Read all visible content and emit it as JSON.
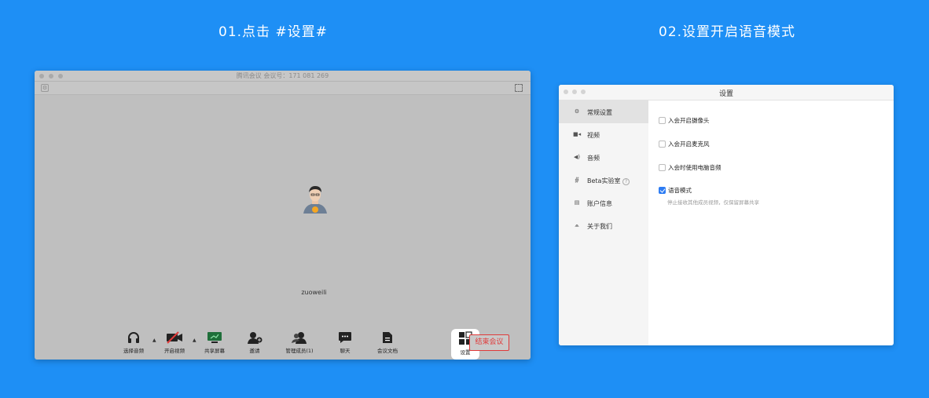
{
  "steps": {
    "step1": "01.点击 #设置#",
    "step2": "02.设置开启语音模式"
  },
  "meeting": {
    "title": "腾讯会议 会议号：171 081 269",
    "participant_name": "zuoweili",
    "toolbar": [
      {
        "label": "选择音频",
        "icon": "headphones-icon"
      },
      {
        "label": "开启视频",
        "icon": "video-off-icon"
      },
      {
        "label": "共享屏幕",
        "icon": "share-screen-icon"
      },
      {
        "label": "邀请",
        "icon": "invite-icon"
      },
      {
        "label": "管理成员(1)",
        "icon": "members-icon"
      },
      {
        "label": "聊天",
        "icon": "chat-icon"
      },
      {
        "label": "会议文档",
        "icon": "document-icon"
      },
      {
        "label": "设置",
        "icon": "settings-grid-icon"
      }
    ],
    "end_button": "结束会议"
  },
  "settings": {
    "title": "设置",
    "nav": [
      {
        "label": "常规设置",
        "icon": "gear-icon",
        "active": true
      },
      {
        "label": "视频",
        "icon": "camera-icon"
      },
      {
        "label": "音频",
        "icon": "speaker-icon"
      },
      {
        "label": "Beta实验室",
        "icon": "flask-icon"
      },
      {
        "label": "账户信息",
        "icon": "id-card-icon"
      },
      {
        "label": "关于我们",
        "icon": "info-icon"
      }
    ],
    "beta_help": "?",
    "options": [
      {
        "label": "入会开启摄像头",
        "checked": false
      },
      {
        "label": "入会开启麦克风",
        "checked": false
      },
      {
        "label": "入会时使用电脑音频",
        "checked": false
      },
      {
        "label": "语音模式",
        "checked": true
      }
    ],
    "voice_mode_desc": "停止接收其他成员视频，仅保留屏幕共享",
    "accent": "#2d7cf3"
  },
  "colors": {
    "background": "#1e8ff5",
    "end_button": "#e03a3a"
  }
}
